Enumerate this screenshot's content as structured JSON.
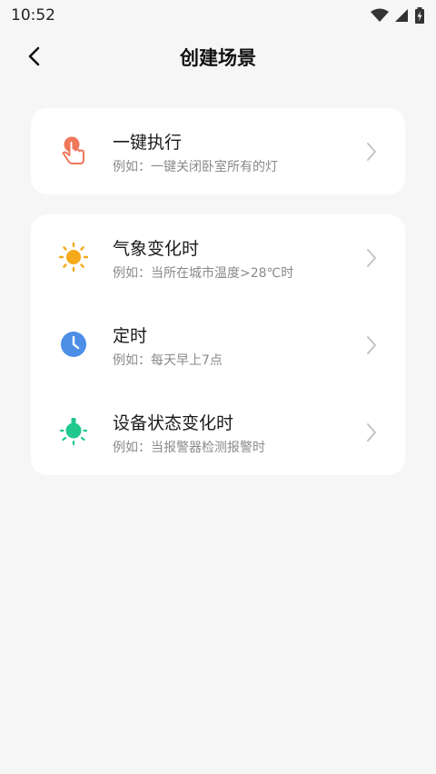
{
  "status_bar": {
    "time": "10:52",
    "icons": [
      "wifi-icon",
      "signal-icon",
      "battery-charging-icon"
    ]
  },
  "header": {
    "title": "创建场景",
    "back_icon": "chevron-left-icon"
  },
  "cards": [
    {
      "rows": [
        {
          "title": "一键执行",
          "subtitle": "例如：一键关闭卧室所有的灯",
          "icon": "tap-hand-icon",
          "icon_color": "#f0775a"
        }
      ]
    },
    {
      "rows": [
        {
          "title": "气象变化时",
          "subtitle": "例如：当所在城市温度>28℃时",
          "icon": "sun-icon",
          "icon_color": "#f6a91b"
        },
        {
          "title": "定时",
          "subtitle": "例如：每天早上7点",
          "icon": "clock-icon",
          "icon_color": "#4d8fe6"
        },
        {
          "title": "设备状态变化时",
          "subtitle": "例如：当报警器检测报警时",
          "icon": "bulb-icon",
          "icon_color": "#1fc98e"
        }
      ]
    }
  ],
  "colors": {
    "background": "#f6f6f6",
    "card": "#ffffff",
    "title_text": "#1a1a1a",
    "subtitle_text": "#8a8a8a",
    "chevron": "#c4c4c4"
  }
}
